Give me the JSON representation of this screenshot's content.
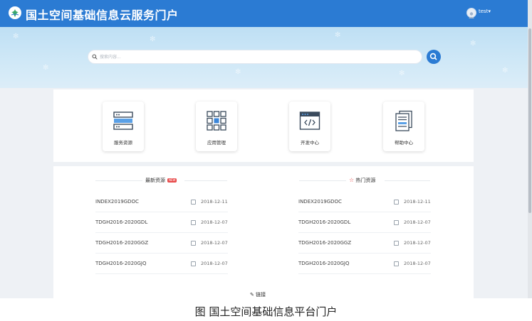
{
  "header": {
    "title": "国土空间基础信息云服务门户",
    "user_name": "test"
  },
  "search": {
    "placeholder": "搜索内容..."
  },
  "tiles": [
    {
      "label": "服务资源",
      "icon": "server-icon"
    },
    {
      "label": "应用管理",
      "icon": "grid-icon"
    },
    {
      "label": "开发中心",
      "icon": "code-icon"
    },
    {
      "label": "帮助中心",
      "icon": "document-icon"
    }
  ],
  "latest": {
    "title": "最新资源",
    "badge": "NEW",
    "rows": [
      {
        "name": "INDEX2019GDOC",
        "date": "2018-12-11"
      },
      {
        "name": "TDGH2016-2020GDL",
        "date": "2018-12-07"
      },
      {
        "name": "TDGH2016-2020GGZ",
        "date": "2018-12-07"
      },
      {
        "name": "TDGH2016-2020GJQ",
        "date": "2018-12-07"
      }
    ]
  },
  "hot": {
    "title": "热门资源",
    "rows": [
      {
        "name": "INDEX2019GDOC",
        "date": "2018-12-11"
      },
      {
        "name": "TDGH2016-2020GDL",
        "date": "2018-12-07"
      },
      {
        "name": "TDGH2016-2020GGZ",
        "date": "2018-12-07"
      },
      {
        "name": "TDGH2016-2020GJQ",
        "date": "2018-12-07"
      }
    ]
  },
  "links": {
    "label": "链接"
  },
  "caption": "图 国土空间基础信息平台门户",
  "colors": {
    "brand": "#2b7bd3",
    "accent_red": "#e84a4a",
    "page_bg": "#eef1f5"
  }
}
